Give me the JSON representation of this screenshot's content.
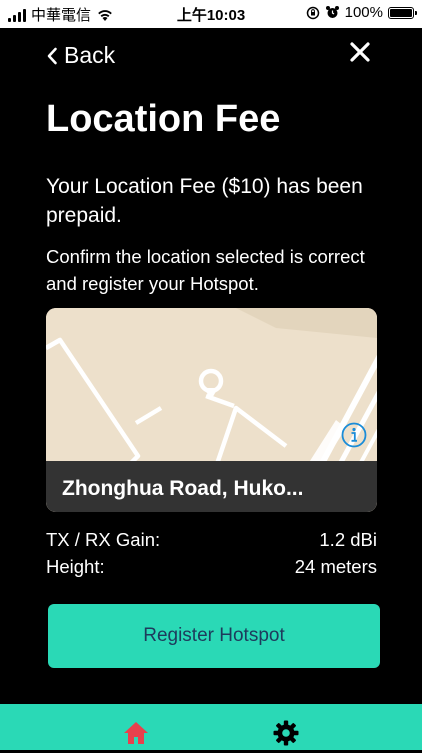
{
  "status_bar": {
    "carrier": "中華電信",
    "time": "上午10:03",
    "battery": "100%"
  },
  "header": {
    "back_label": "Back"
  },
  "page": {
    "title": "Location Fee",
    "subtitle": "Your Location Fee ($10) has been prepaid.",
    "instruction": "Confirm the location selected is correct and register your Hotspot."
  },
  "map": {
    "address": "Zhonghua Road, Huko..."
  },
  "specs": [
    {
      "label": "TX / RX Gain:",
      "value": "1.2 dBi"
    },
    {
      "label": "Height:",
      "value": "24 meters"
    }
  ],
  "actions": {
    "register_label": "Register Hotspot"
  },
  "tab_bar": {
    "active_tab": "home",
    "icons": [
      "home-icon",
      "gear-icon"
    ]
  },
  "colors": {
    "accent": "#2ad9b6",
    "home_active": "#e8414d",
    "button_text": "#1e3b5c",
    "map_land": "#ede0cb"
  }
}
